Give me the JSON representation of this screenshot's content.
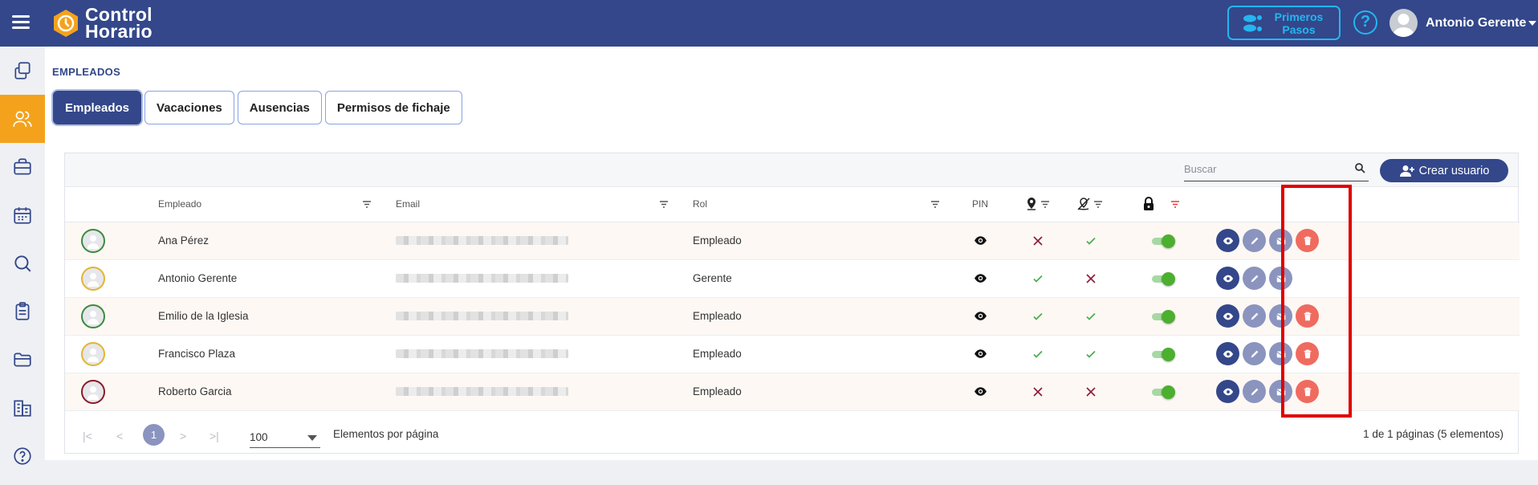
{
  "topbar": {
    "logo_line1": "Control",
    "logo_line2": "Horario",
    "first_steps_line1": "Primeros",
    "first_steps_line2": "Pasos",
    "help_label": "?",
    "user_name": "Antonio Gerente",
    "colors": {
      "bar": "#33478a",
      "accent": "#24b6f0",
      "logo": "#f4a21c"
    }
  },
  "sidebar": {
    "items": [
      {
        "icon": "copy-icon",
        "active": false
      },
      {
        "icon": "users-icon",
        "active": true
      },
      {
        "icon": "briefcase-icon",
        "active": false
      },
      {
        "icon": "calendar-icon",
        "active": false
      },
      {
        "icon": "search-icon",
        "active": false
      },
      {
        "icon": "clipboard-icon",
        "active": false
      },
      {
        "icon": "folder-icon",
        "active": false
      },
      {
        "icon": "buildings-icon",
        "active": false
      },
      {
        "icon": "help-icon",
        "active": false
      }
    ]
  },
  "page": {
    "title": "EMPLEADOS",
    "tabs": [
      "Empleados",
      "Vacaciones",
      "Ausencias",
      "Permisos de fichaje"
    ],
    "active_tab": "Empleados"
  },
  "toolbar": {
    "search_placeholder": "Buscar",
    "create_label": "Crear usuario"
  },
  "table": {
    "headers": {
      "employee": "Empleado",
      "email": "Email",
      "role": "Rol",
      "pin": "PIN"
    },
    "rows": [
      {
        "name": "Ana Pérez",
        "role": "Empleado",
        "avatar_color": "#3d8a3d",
        "location": false,
        "remote": true,
        "locked": true,
        "can_delete": true
      },
      {
        "name": "Antonio Gerente",
        "role": "Gerente",
        "avatar_color": "#e5b430",
        "location": true,
        "remote": false,
        "locked": true,
        "can_delete": false
      },
      {
        "name": "Emilio de la Iglesia",
        "role": "Empleado",
        "avatar_color": "#3d8a3d",
        "location": true,
        "remote": true,
        "locked": true,
        "can_delete": true
      },
      {
        "name": "Francisco Plaza",
        "role": "Empleado",
        "avatar_color": "#e5b430",
        "location": true,
        "remote": true,
        "locked": true,
        "can_delete": true
      },
      {
        "name": "Roberto Garcia",
        "role": "Empleado",
        "avatar_color": "#8b1a2a",
        "location": false,
        "remote": false,
        "locked": true,
        "can_delete": true
      }
    ]
  },
  "pager": {
    "first": "|<",
    "prev": "<",
    "current_page": "1",
    "next": ">",
    "last": ">|",
    "page_size": "100",
    "per_page_label": "Elementos por página",
    "info": "1 de 1 páginas (5 elementos)"
  }
}
